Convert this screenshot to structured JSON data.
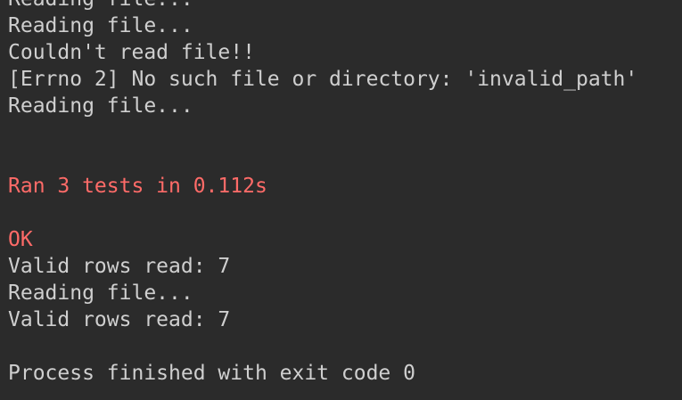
{
  "console": {
    "lines": [
      {
        "text": "Reading file...",
        "kind": "stdout"
      },
      {
        "text": "Reading file...",
        "kind": "stdout"
      },
      {
        "text": "Couldn't read file!!",
        "kind": "stdout"
      },
      {
        "text": "[Errno 2] No such file or directory: 'invalid_path'",
        "kind": "stdout"
      },
      {
        "text": "Reading file...",
        "kind": "stdout"
      },
      {
        "text": "",
        "kind": "stdout"
      },
      {
        "text": "",
        "kind": "stdout"
      },
      {
        "text": "Ran 3 tests in 0.112s",
        "kind": "stderr"
      },
      {
        "text": "",
        "kind": "stdout"
      },
      {
        "text": "OK",
        "kind": "stderr"
      },
      {
        "text": "Valid rows read: 7",
        "kind": "stdout"
      },
      {
        "text": "Reading file...",
        "kind": "stdout"
      },
      {
        "text": "Valid rows read: 7",
        "kind": "stdout"
      },
      {
        "text": "",
        "kind": "stdout"
      },
      {
        "text": "Process finished with exit code 0",
        "kind": "stdout"
      }
    ]
  },
  "colors": {
    "background": "#2b2b2b",
    "stdout": "#cfcfcf",
    "stderr": "#ff6b68"
  }
}
